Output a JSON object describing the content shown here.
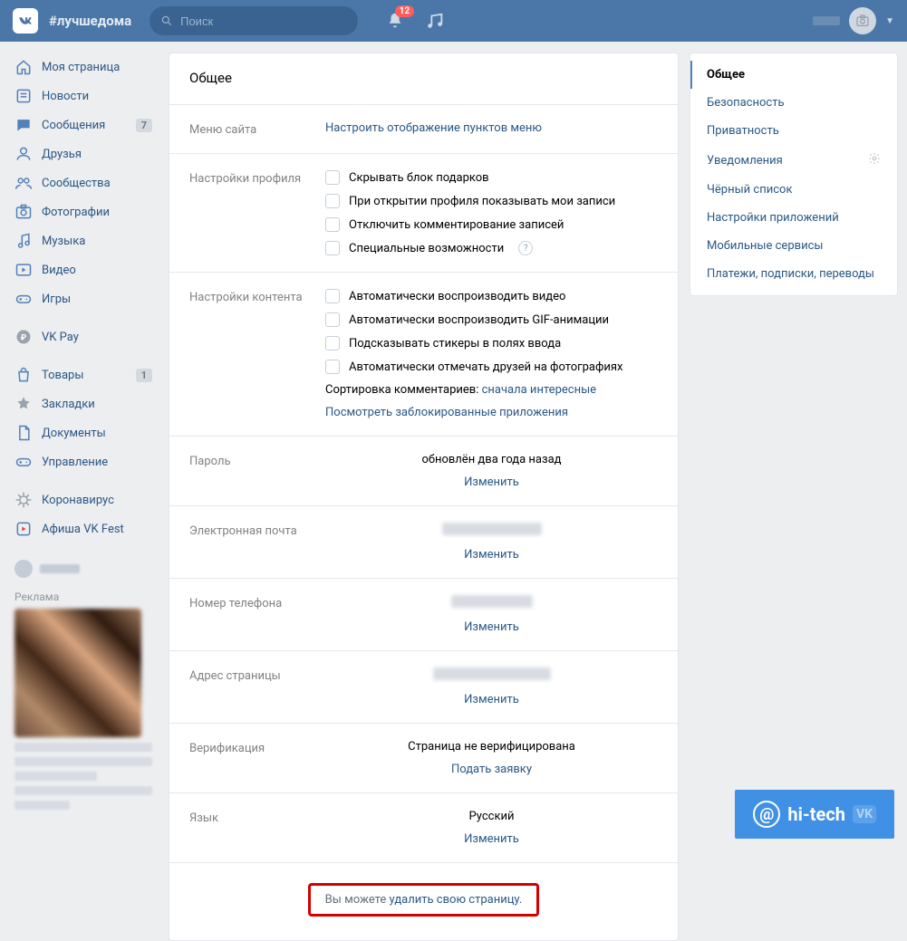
{
  "header": {
    "hashtag": "#лучшедома",
    "search_placeholder": "Поиск",
    "notif_count": "12"
  },
  "sidebar": {
    "items": [
      {
        "icon": "home",
        "label": "Моя страница"
      },
      {
        "icon": "news",
        "label": "Новости"
      },
      {
        "icon": "msg",
        "label": "Сообщения",
        "count": "7"
      },
      {
        "icon": "friends",
        "label": "Друзья"
      },
      {
        "icon": "groups",
        "label": "Сообщества"
      },
      {
        "icon": "photo",
        "label": "Фотографии"
      },
      {
        "icon": "music",
        "label": "Музыка"
      },
      {
        "icon": "video",
        "label": "Видео"
      },
      {
        "icon": "games",
        "label": "Игры"
      }
    ],
    "items2": [
      {
        "icon": "pay",
        "label": "VK Pay"
      }
    ],
    "items3": [
      {
        "icon": "market",
        "label": "Товары",
        "count": "1"
      },
      {
        "icon": "bookmark",
        "label": "Закладки"
      },
      {
        "icon": "docs",
        "label": "Документы"
      },
      {
        "icon": "manage",
        "label": "Управление"
      }
    ],
    "items4": [
      {
        "icon": "covid",
        "label": "Коронавирус"
      },
      {
        "icon": "afisha",
        "label": "Афиша VK Fest"
      }
    ],
    "ad_label": "Реклама"
  },
  "settings": {
    "title": "Общее",
    "menu": {
      "label": "Меню сайта",
      "link": "Настроить отображение пунктов меню"
    },
    "profile": {
      "label": "Настройки профиля",
      "opts": [
        "Скрывать блок подарков",
        "При открытии профиля показывать мои записи",
        "Отключить комментирование записей",
        "Специальные возможности"
      ]
    },
    "content": {
      "label": "Настройки контента",
      "opts": [
        "Автоматически воспроизводить видео",
        "Автоматически воспроизводить GIF-анимации",
        "Подсказывать стикеры в полях ввода",
        "Автоматически отмечать друзей на фотографиях"
      ],
      "sort_label": "Сортировка комментариев:",
      "sort_link": "сначала интересные",
      "blocked_link": "Посмотреть заблокированные приложения"
    },
    "password": {
      "label": "Пароль",
      "value": "обновлён два года назад",
      "action": "Изменить"
    },
    "email": {
      "label": "Электронная почта",
      "action": "Изменить"
    },
    "phone": {
      "label": "Номер телефона",
      "action": "Изменить"
    },
    "address": {
      "label": "Адрес страницы",
      "action": "Изменить"
    },
    "verify": {
      "label": "Верификация",
      "value": "Страница не верифицирована",
      "action": "Подать заявку"
    },
    "lang": {
      "label": "Язык",
      "value": "Русский",
      "action": "Изменить"
    },
    "delete": {
      "prefix": "Вы можете ",
      "link": "удалить свою страницу."
    }
  },
  "tabs": [
    {
      "label": "Общее",
      "active": true
    },
    {
      "label": "Безопасность"
    },
    {
      "label": "Приватность"
    },
    {
      "label": "Уведомления",
      "gear": true
    },
    {
      "label": "Чёрный список"
    },
    {
      "label": "Настройки приложений"
    },
    {
      "label": "Мобильные сервисы"
    },
    {
      "label": "Платежи, подписки, переводы"
    }
  ],
  "watermark": {
    "text": "hi-tech"
  }
}
